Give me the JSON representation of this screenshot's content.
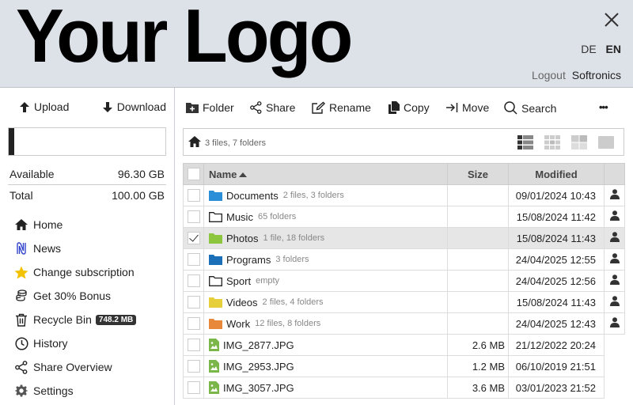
{
  "header": {
    "logo": "Your Logo",
    "languages": [
      "DE",
      "EN"
    ],
    "active_language": "EN",
    "logout": "Logout",
    "username": "Softronics"
  },
  "sidebar": {
    "upload": "Upload",
    "download": "Download",
    "quota_used_fraction": 0.037,
    "available_label": "Available",
    "available_value": "96.30 GB",
    "total_label": "Total",
    "total_value": "100.00 GB",
    "nav": [
      {
        "label": "Home",
        "icon": "home-icon"
      },
      {
        "label": "News",
        "icon": "news-icon"
      },
      {
        "label": "Change subscription",
        "icon": "star-icon"
      },
      {
        "label": "Get 30% Bonus",
        "icon": "coins-icon"
      },
      {
        "label": "Recycle Bin",
        "icon": "trash-icon",
        "badge": "748.2 MB"
      },
      {
        "label": "History",
        "icon": "clock-icon"
      },
      {
        "label": "Share Overview",
        "icon": "share-icon"
      },
      {
        "label": "Settings",
        "icon": "gear-icon"
      }
    ]
  },
  "toolbar": {
    "folder": "Folder",
    "share": "Share",
    "rename": "Rename",
    "copy": "Copy",
    "move": "Move",
    "search": "Search",
    "more": "•••"
  },
  "breadcrumb": {
    "info": "3 files, 7 folders"
  },
  "table": {
    "headers": {
      "name": "Name",
      "size": "Size",
      "modified": "Modified"
    },
    "rows": [
      {
        "type": "folder",
        "color": "#2a8fd6",
        "name": "Documents",
        "meta": "2 files, 3 folders",
        "size": "",
        "modified": "09/01/2024 10:43",
        "owner": true,
        "selected": false
      },
      {
        "type": "folder",
        "color": "outline",
        "name": "Music",
        "meta": "65 folders",
        "size": "",
        "modified": "15/08/2024 11:42",
        "owner": true,
        "selected": false
      },
      {
        "type": "folder",
        "color": "#8cc63f",
        "name": "Photos",
        "meta": "1 file, 18 folders",
        "size": "",
        "modified": "15/08/2024 11:43",
        "owner": true,
        "selected": true
      },
      {
        "type": "folder",
        "color": "#1a6fb8",
        "name": "Programs",
        "meta": "3 folders",
        "size": "",
        "modified": "24/04/2025 12:55",
        "owner": true,
        "selected": false
      },
      {
        "type": "folder",
        "color": "outline",
        "name": "Sport",
        "meta": "empty",
        "size": "",
        "modified": "24/04/2025 12:56",
        "owner": true,
        "selected": false
      },
      {
        "type": "folder",
        "color": "#e6cf3a",
        "name": "Videos",
        "meta": "2 files, 4 folders",
        "size": "",
        "modified": "15/08/2024 11:43",
        "owner": true,
        "selected": false
      },
      {
        "type": "folder",
        "color": "#e8883a",
        "name": "Work",
        "meta": "12 files, 8 folders",
        "size": "",
        "modified": "24/04/2025 12:43",
        "owner": true,
        "selected": false
      },
      {
        "type": "image",
        "color": "#7ab648",
        "name": "IMG_2877.JPG",
        "meta": "",
        "size": "2.6 MB",
        "modified": "21/12/2022 20:24",
        "owner": false,
        "selected": false
      },
      {
        "type": "image",
        "color": "#7ab648",
        "name": "IMG_2953.JPG",
        "meta": "",
        "size": "1.2 MB",
        "modified": "06/10/2019 21:51",
        "owner": false,
        "selected": false
      },
      {
        "type": "image",
        "color": "#7ab648",
        "name": "IMG_3057.JPG",
        "meta": "",
        "size": "3.6 MB",
        "modified": "03/01/2023 21:52",
        "owner": false,
        "selected": false
      }
    ]
  }
}
